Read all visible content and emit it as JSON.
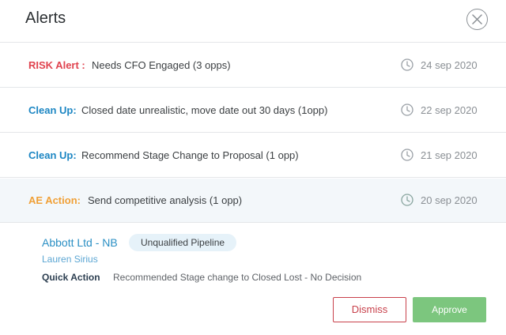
{
  "header": {
    "title": "Alerts"
  },
  "colors": {
    "risk": "#e0434f",
    "cleanup": "#1c86c3",
    "ae_action": "#f0a037",
    "link": "#2a8fc4",
    "dismiss": "#c8414b",
    "approve": "#7cc67e"
  },
  "alerts": [
    {
      "label": "RISK Alert :",
      "message": "Needs CFO Engaged (3 opps)",
      "date": "24 sep 2020"
    },
    {
      "label": "Clean Up:",
      "message": "Closed date unrealistic, move date out 30 days (1opp)",
      "date": "22 sep 2020"
    },
    {
      "label": "Clean Up:",
      "message": "Recommend Stage Change to Proposal (1 opp)",
      "date": "21 sep 2020"
    },
    {
      "label": "AE Action:",
      "message": "Send competitive analysis (1 opp)",
      "date": "20 sep 2020"
    }
  ],
  "detail": {
    "account": "Abbott Ltd - NB",
    "badge": "Unqualified Pipeline",
    "owner": "Lauren Sirius",
    "quick_action_label": "Quick Action",
    "quick_action_text": "Recommended Stage change to Closed Lost - No Decision"
  },
  "actions": {
    "dismiss": "Dismiss",
    "approve": "Approve"
  }
}
